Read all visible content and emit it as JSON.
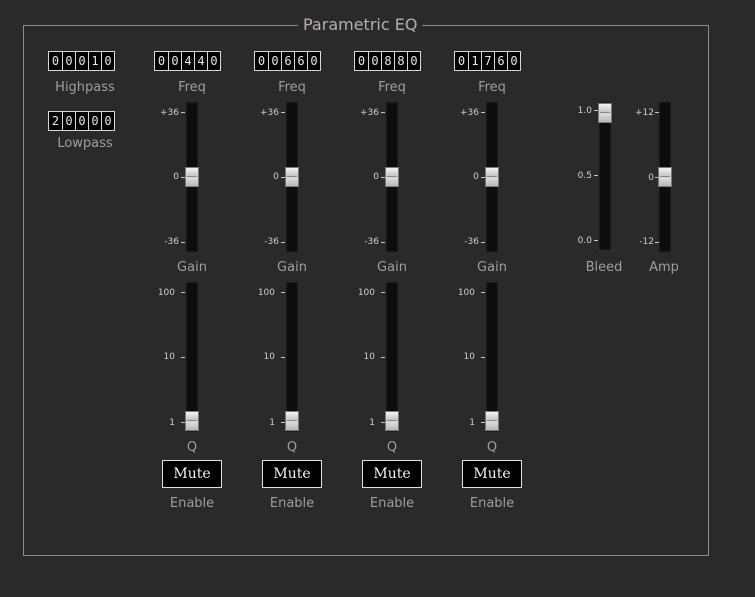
{
  "title": "Parametric EQ",
  "highpass": {
    "digits": [
      "0",
      "0",
      "0",
      "1",
      "0"
    ],
    "label": "Highpass"
  },
  "lowpass": {
    "digits": [
      "2",
      "0",
      "0",
      "0",
      "0"
    ],
    "label": "Lowpass"
  },
  "bands": [
    {
      "freq_digits": [
        "0",
        "0",
        "4",
        "4",
        "0"
      ],
      "freq_label": "Freq",
      "gain_label": "Gain",
      "gain_value": 0,
      "q_label": "Q",
      "q_value": 1,
      "mute_label": "Mute",
      "enable_label": "Enable"
    },
    {
      "freq_digits": [
        "0",
        "0",
        "6",
        "6",
        "0"
      ],
      "freq_label": "Freq",
      "gain_label": "Gain",
      "gain_value": 0,
      "q_label": "Q",
      "q_value": 1,
      "mute_label": "Mute",
      "enable_label": "Enable"
    },
    {
      "freq_digits": [
        "0",
        "0",
        "8",
        "8",
        "0"
      ],
      "freq_label": "Freq",
      "gain_label": "Gain",
      "gain_value": 0,
      "q_label": "Q",
      "q_value": 1,
      "mute_label": "Mute",
      "enable_label": "Enable"
    },
    {
      "freq_digits": [
        "0",
        "1",
        "7",
        "6",
        "0"
      ],
      "freq_label": "Freq",
      "gain_label": "Gain",
      "gain_value": 0,
      "q_label": "Q",
      "q_value": 1,
      "mute_label": "Mute",
      "enable_label": "Enable"
    }
  ],
  "gain_scale": {
    "top": "+36",
    "mid": "0",
    "bottom": "-36"
  },
  "q_scale": {
    "top": "100",
    "mid": "10",
    "bottom": "1"
  },
  "bleed": {
    "label": "Bleed",
    "value": 1.0,
    "scale": {
      "top": "1.0",
      "mid": "0.5",
      "bottom": "0.0"
    }
  },
  "amp": {
    "label": "Amp",
    "value": 0,
    "scale": {
      "top": "+12",
      "mid": "0",
      "bottom": "-12"
    }
  }
}
